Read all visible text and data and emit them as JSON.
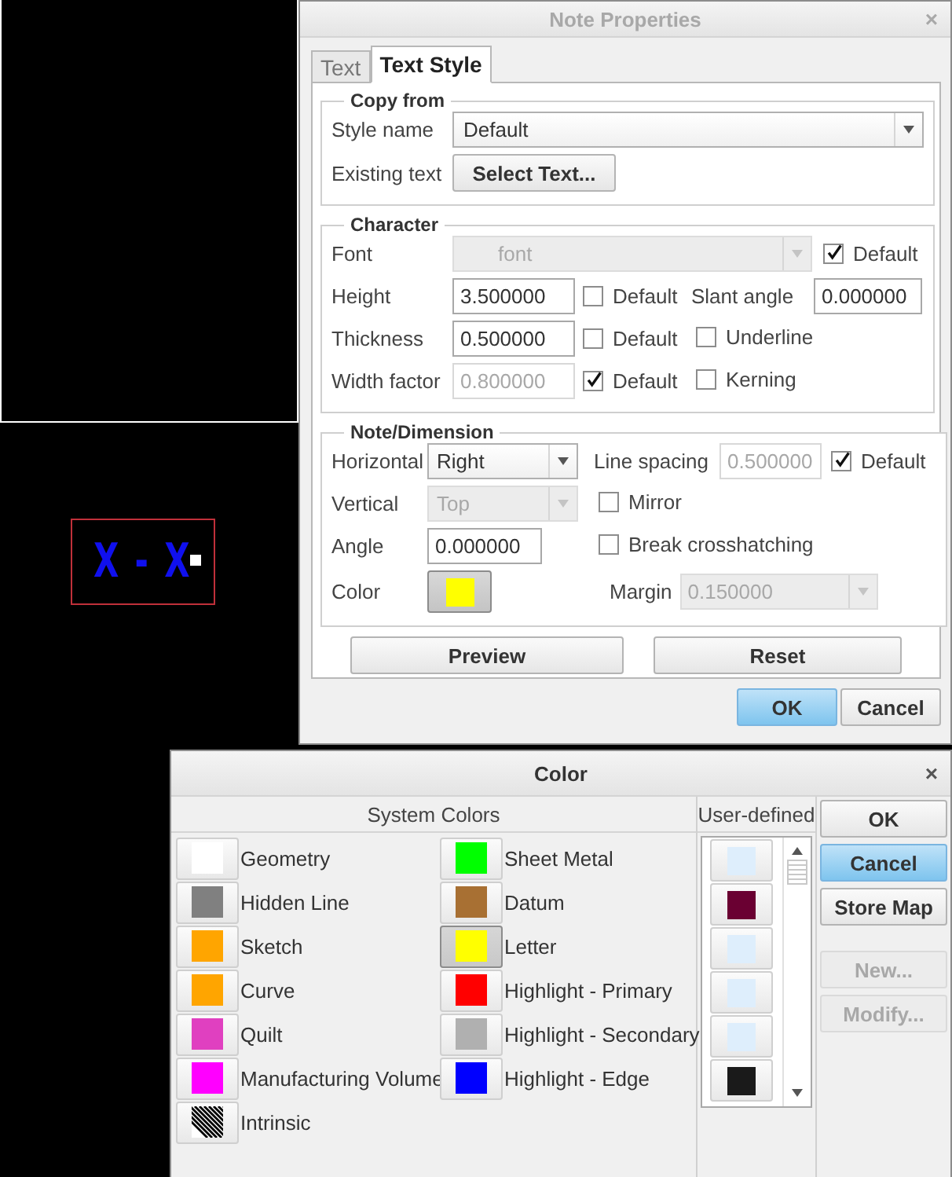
{
  "canvas": {
    "note_text": "X - X",
    "note_selected": true
  },
  "note_properties": {
    "title": "Note Properties",
    "active": false,
    "close": "×",
    "tabs": [
      {
        "label": "Text",
        "selected": false
      },
      {
        "label": "Text Style",
        "selected": true
      }
    ],
    "copy_from": {
      "legend": "Copy from",
      "style_name_label": "Style name",
      "style_name_value": "Default",
      "existing_text_label": "Existing text",
      "select_text_button": "Select Text..."
    },
    "character": {
      "legend": "Character",
      "font": {
        "label": "Font",
        "value": "font",
        "disabled": true,
        "default": {
          "label": "Default",
          "checked": true
        }
      },
      "height": {
        "label": "Height",
        "value": "3.500000",
        "disabled": false,
        "default": {
          "label": "Default",
          "checked": false
        }
      },
      "slant_angle": {
        "label": "Slant angle",
        "value": "0.000000",
        "disabled": false
      },
      "thickness": {
        "label": "Thickness",
        "value": "0.500000",
        "disabled": false,
        "default": {
          "label": "Default",
          "checked": false
        }
      },
      "underline": {
        "label": "Underline",
        "checked": false
      },
      "width_factor": {
        "label": "Width factor",
        "value": "0.800000",
        "disabled": true,
        "default": {
          "label": "Default",
          "checked": true
        }
      },
      "kerning": {
        "label": "Kerning",
        "checked": false
      }
    },
    "note_dimension": {
      "legend": "Note/Dimension",
      "horizontal": {
        "label": "Horizontal",
        "value": "Right",
        "disabled": false
      },
      "line_spacing": {
        "label": "Line spacing",
        "value": "0.500000",
        "disabled": true,
        "default": {
          "label": "Default",
          "checked": true
        }
      },
      "vertical": {
        "label": "Vertical",
        "value": "Top",
        "disabled": true
      },
      "mirror": {
        "label": "Mirror",
        "checked": false
      },
      "angle": {
        "label": "Angle",
        "value": "0.000000",
        "disabled": false
      },
      "break_crosshatching": {
        "label": "Break crosshatching",
        "checked": false
      },
      "color": {
        "label": "Color",
        "color": "#ffff00"
      },
      "margin": {
        "label": "Margin",
        "value": "0.150000",
        "disabled": true
      }
    },
    "actions": [
      "Preview",
      "Reset"
    ],
    "buttons": [
      {
        "label": "OK",
        "selected": true
      },
      {
        "label": "Cancel",
        "selected": false
      }
    ]
  },
  "color_dialog": {
    "title": "Color",
    "active": true,
    "close": "×",
    "system_header": "System Colors",
    "user_header": "User-defined",
    "system_colors": [
      {
        "label": "Geometry",
        "kind": "solid",
        "color": "#ffffff",
        "selected": false
      },
      {
        "label": "Hidden Line",
        "kind": "solid",
        "color": "#808080",
        "selected": false
      },
      {
        "label": "Sketch",
        "kind": "solid",
        "color": "#ffa500",
        "selected": false
      },
      {
        "label": "Curve",
        "kind": "solid",
        "color": "#ffa500",
        "selected": false
      },
      {
        "label": "Quilt",
        "kind": "solid",
        "color": "#e040c0",
        "selected": false
      },
      {
        "label": "Manufacturing Volume",
        "kind": "solid",
        "color": "#ff00ff",
        "selected": false
      },
      {
        "label": "Intrinsic",
        "kind": "hatch",
        "selected": false
      },
      {
        "label": "Sheet Metal",
        "kind": "solid",
        "color": "#00ff00",
        "selected": false
      },
      {
        "label": "Datum",
        "kind": "solid",
        "color": "#a87033",
        "selected": false
      },
      {
        "label": "Letter",
        "kind": "solid",
        "color": "#ffff00",
        "selected": true
      },
      {
        "label": "Highlight - Primary",
        "kind": "solid",
        "color": "#ff0000",
        "selected": false
      },
      {
        "label": "Highlight - Secondary",
        "kind": "solid",
        "color": "#b0b0b0",
        "selected": false
      },
      {
        "label": "Highlight - Edge",
        "kind": "solid",
        "color": "#0000ff",
        "selected": false
      }
    ],
    "user_colors": [
      {
        "color": "#deeefc"
      },
      {
        "color": "#6a0032"
      },
      {
        "color": "#deeefc"
      },
      {
        "color": "#deeefc"
      },
      {
        "color": "#deeefc"
      },
      {
        "color": "#1a1a1a"
      }
    ],
    "buttons": [
      {
        "label": "OK",
        "selected": false,
        "disabled": false
      },
      {
        "label": "Cancel",
        "selected": true,
        "disabled": false
      },
      {
        "label": "Store Map",
        "selected": false,
        "disabled": false
      },
      {
        "label": "New...",
        "selected": false,
        "disabled": true
      },
      {
        "label": "Modify...",
        "selected": false,
        "disabled": true
      }
    ]
  }
}
